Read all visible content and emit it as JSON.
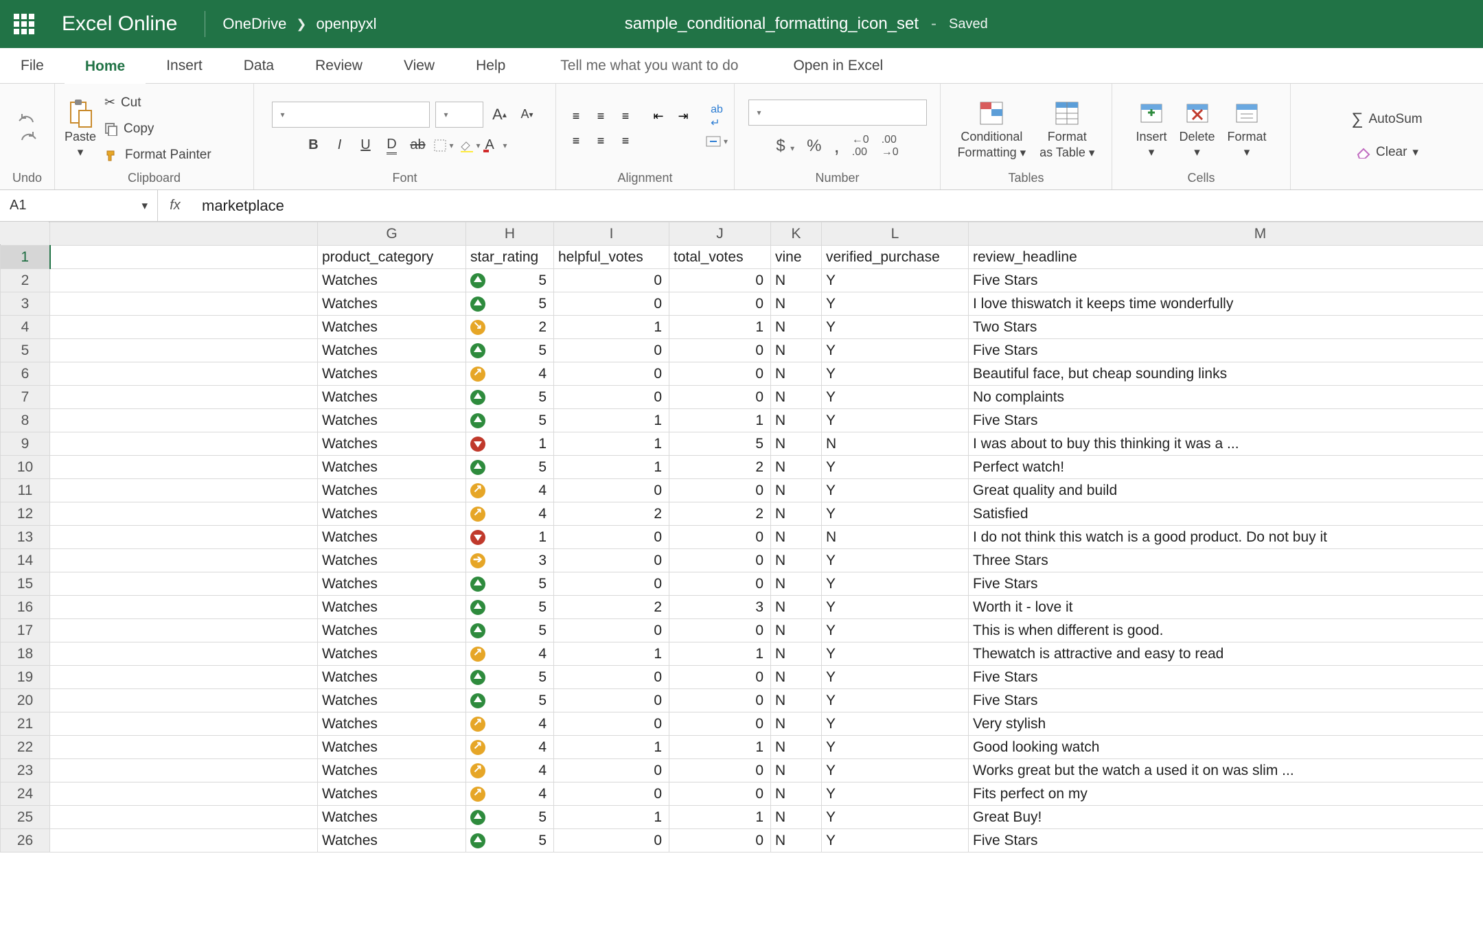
{
  "titlebar": {
    "app_name": "Excel Online",
    "breadcrumb_root": "OneDrive",
    "breadcrumb_leaf": "openpyxl",
    "doc_title": "sample_conditional_formatting_icon_set",
    "separator": "-",
    "status": "Saved"
  },
  "menu": {
    "file": "File",
    "home": "Home",
    "insert": "Insert",
    "data": "Data",
    "review": "Review",
    "view": "View",
    "help": "Help",
    "tellme": "Tell me what you want to do",
    "open_excel": "Open in Excel"
  },
  "ribbon": {
    "undo_group": "Undo",
    "clipboard": {
      "paste": "Paste",
      "cut": "Cut",
      "copy": "Copy",
      "format_painter": "Format Painter",
      "group": "Clipboard"
    },
    "font": {
      "group": "Font",
      "bold": "B",
      "italic": "I",
      "underline": "U"
    },
    "alignment": {
      "group": "Alignment"
    },
    "number": {
      "group": "Number",
      "dollar": "$",
      "percent": "%",
      "comma": ","
    },
    "tables": {
      "group": "Tables",
      "conditional": "Conditional",
      "formatting": "Formatting",
      "format": "Format",
      "as_table": "as Table"
    },
    "cells": {
      "group": "Cells",
      "insert": "Insert",
      "delete": "Delete",
      "format": "Format"
    },
    "editing": {
      "autosum": "AutoSum",
      "clear": "Clear"
    }
  },
  "formula_bar": {
    "name_box": "A1",
    "fx": "fx",
    "value": "marketplace"
  },
  "columns": [
    "G",
    "H",
    "I",
    "J",
    "K",
    "L",
    "M"
  ],
  "headers": {
    "G": "product_category",
    "H": "star_rating",
    "I": "helpful_votes",
    "J": "total_votes",
    "K": "vine",
    "L": "verified_purchase",
    "M": "review_headline"
  },
  "rows": [
    {
      "n": 2,
      "G": "Watches",
      "icon": "up",
      "H": 5,
      "I": 0,
      "J": 0,
      "K": "N",
      "L": "Y",
      "M": "Five Stars"
    },
    {
      "n": 3,
      "G": "Watches",
      "icon": "up",
      "H": 5,
      "I": 0,
      "J": 0,
      "K": "N",
      "L": "Y",
      "M": "I love thiswatch it keeps time wonderfully"
    },
    {
      "n": 4,
      "G": "Watches",
      "icon": "ddiag",
      "H": 2,
      "I": 1,
      "J": 1,
      "K": "N",
      "L": "Y",
      "M": "Two Stars"
    },
    {
      "n": 5,
      "G": "Watches",
      "icon": "up",
      "H": 5,
      "I": 0,
      "J": 0,
      "K": "N",
      "L": "Y",
      "M": "Five Stars"
    },
    {
      "n": 6,
      "G": "Watches",
      "icon": "diag",
      "H": 4,
      "I": 0,
      "J": 0,
      "K": "N",
      "L": "Y",
      "M": "Beautiful face, but cheap sounding links"
    },
    {
      "n": 7,
      "G": "Watches",
      "icon": "up",
      "H": 5,
      "I": 0,
      "J": 0,
      "K": "N",
      "L": "Y",
      "M": "No complaints"
    },
    {
      "n": 8,
      "G": "Watches",
      "icon": "up",
      "H": 5,
      "I": 1,
      "J": 1,
      "K": "N",
      "L": "Y",
      "M": "Five Stars"
    },
    {
      "n": 9,
      "G": "Watches",
      "icon": "down",
      "H": 1,
      "I": 1,
      "J": 5,
      "K": "N",
      "L": "N",
      "M": "I was about to buy this thinking it was a ..."
    },
    {
      "n": 10,
      "G": "Watches",
      "icon": "up",
      "H": 5,
      "I": 1,
      "J": 2,
      "K": "N",
      "L": "Y",
      "M": "Perfect watch!"
    },
    {
      "n": 11,
      "G": "Watches",
      "icon": "diag",
      "H": 4,
      "I": 0,
      "J": 0,
      "K": "N",
      "L": "Y",
      "M": "Great quality and build"
    },
    {
      "n": 12,
      "G": "Watches",
      "icon": "diag",
      "H": 4,
      "I": 2,
      "J": 2,
      "K": "N",
      "L": "Y",
      "M": "Satisfied"
    },
    {
      "n": 13,
      "G": "Watches",
      "icon": "down",
      "H": 1,
      "I": 0,
      "J": 0,
      "K": "N",
      "L": "N",
      "M": "I do not think this watch is a good product. Do not buy it"
    },
    {
      "n": 14,
      "G": "Watches",
      "icon": "side",
      "H": 3,
      "I": 0,
      "J": 0,
      "K": "N",
      "L": "Y",
      "M": "Three Stars"
    },
    {
      "n": 15,
      "G": "Watches",
      "icon": "up",
      "H": 5,
      "I": 0,
      "J": 0,
      "K": "N",
      "L": "Y",
      "M": "Five Stars"
    },
    {
      "n": 16,
      "G": "Watches",
      "icon": "up",
      "H": 5,
      "I": 2,
      "J": 3,
      "K": "N",
      "L": "Y",
      "M": "Worth it - love it"
    },
    {
      "n": 17,
      "G": "Watches",
      "icon": "up",
      "H": 5,
      "I": 0,
      "J": 0,
      "K": "N",
      "L": "Y",
      "M": "This is when different is good."
    },
    {
      "n": 18,
      "G": "Watches",
      "icon": "diag",
      "H": 4,
      "I": 1,
      "J": 1,
      "K": "N",
      "L": "Y",
      "M": "Thewatch is attractive and easy to read"
    },
    {
      "n": 19,
      "G": "Watches",
      "icon": "up",
      "H": 5,
      "I": 0,
      "J": 0,
      "K": "N",
      "L": "Y",
      "M": "Five Stars"
    },
    {
      "n": 20,
      "G": "Watches",
      "icon": "up",
      "H": 5,
      "I": 0,
      "J": 0,
      "K": "N",
      "L": "Y",
      "M": "Five Stars"
    },
    {
      "n": 21,
      "G": "Watches",
      "icon": "diag",
      "H": 4,
      "I": 0,
      "J": 0,
      "K": "N",
      "L": "Y",
      "M": "Very stylish"
    },
    {
      "n": 22,
      "G": "Watches",
      "icon": "diag",
      "H": 4,
      "I": 1,
      "J": 1,
      "K": "N",
      "L": "Y",
      "M": "Good looking watch"
    },
    {
      "n": 23,
      "G": "Watches",
      "icon": "diag",
      "H": 4,
      "I": 0,
      "J": 0,
      "K": "N",
      "L": "Y",
      "M": "Works great but the watch a used it on was slim ..."
    },
    {
      "n": 24,
      "G": "Watches",
      "icon": "diag",
      "H": 4,
      "I": 0,
      "J": 0,
      "K": "N",
      "L": "Y",
      "M": "Fits perfect on my"
    },
    {
      "n": 25,
      "G": "Watches",
      "icon": "up",
      "H": 5,
      "I": 1,
      "J": 1,
      "K": "N",
      "L": "Y",
      "M": "Great Buy!"
    },
    {
      "n": 26,
      "G": "Watches",
      "icon": "up",
      "H": 5,
      "I": 0,
      "J": 0,
      "K": "N",
      "L": "Y",
      "M": "Five Stars"
    }
  ]
}
